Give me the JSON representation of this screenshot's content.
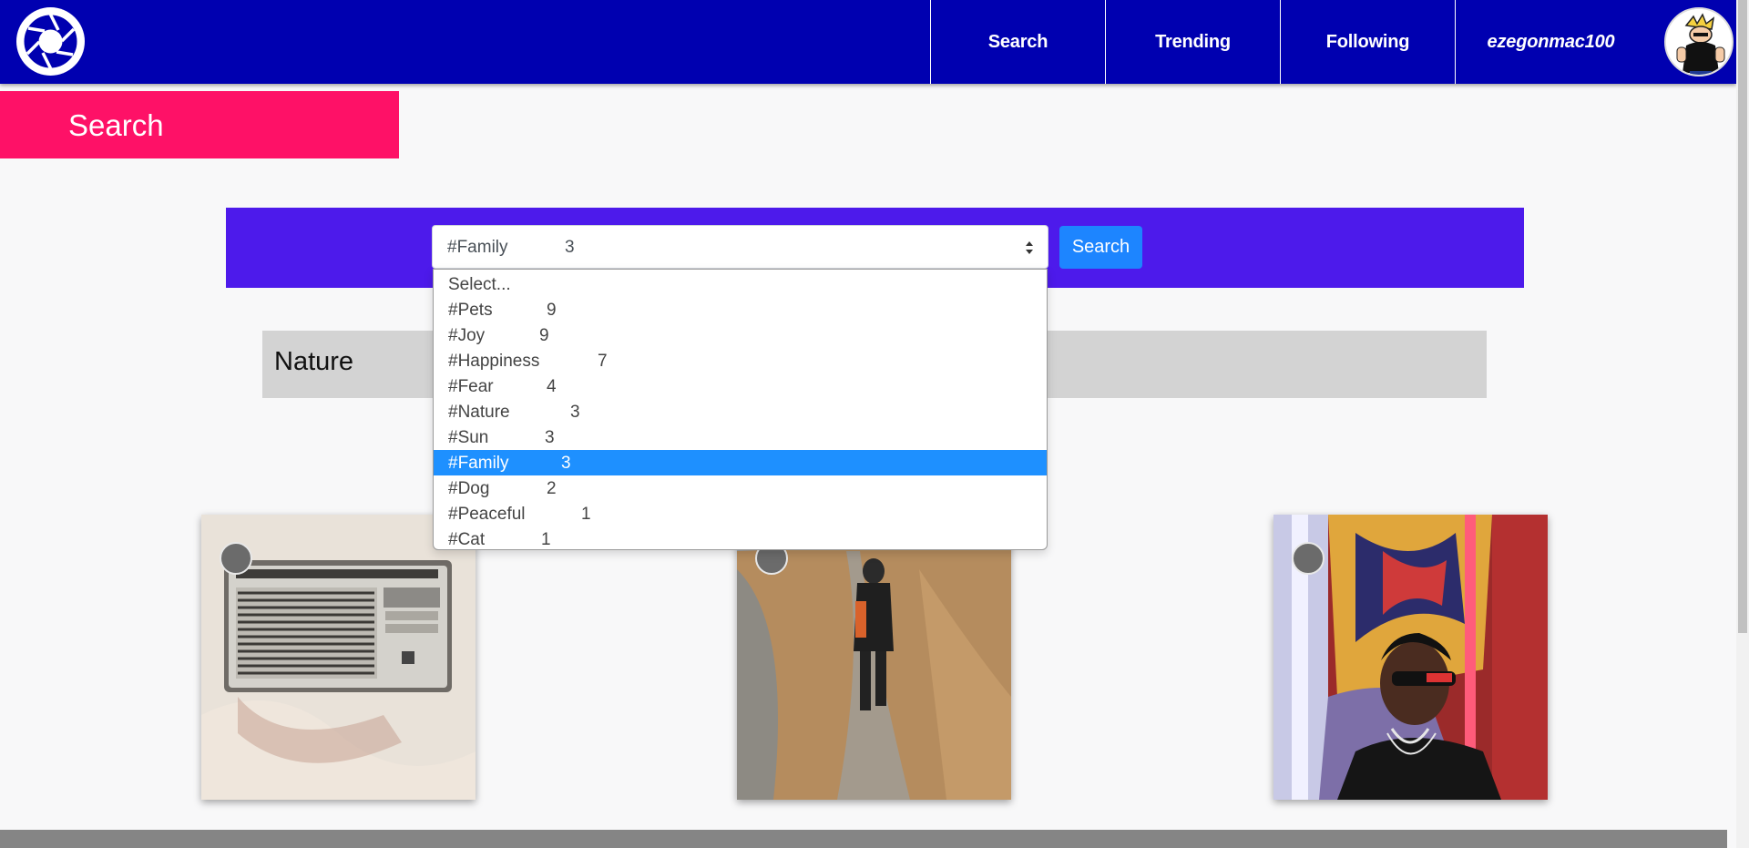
{
  "nav": {
    "logo_icon": "camera-shutter-icon",
    "links": [
      {
        "label": "Search"
      },
      {
        "label": "Trending"
      },
      {
        "label": "Following"
      }
    ],
    "username": "ezegonmac100",
    "avatar_icon": "cartoon-avatar-icon"
  },
  "page_header": {
    "title": "Search"
  },
  "search": {
    "selected": {
      "tag": "#Family",
      "count": "3"
    },
    "button_label": "Search",
    "options": [
      {
        "tag": "Select...",
        "count": ""
      },
      {
        "tag": "#Pets",
        "count": "9"
      },
      {
        "tag": "#Joy",
        "count": "9"
      },
      {
        "tag": "#Happiness",
        "count": "7"
      },
      {
        "tag": "#Fear",
        "count": "4"
      },
      {
        "tag": "#Nature",
        "count": "3"
      },
      {
        "tag": "#Sun",
        "count": "3"
      },
      {
        "tag": "#Family",
        "count": "3"
      },
      {
        "tag": "#Dog",
        "count": "2"
      },
      {
        "tag": "#Peaceful",
        "count": "1"
      },
      {
        "tag": "#Cat",
        "count": "1"
      }
    ],
    "selected_index": 7
  },
  "section": {
    "label": "Nature"
  },
  "colors": {
    "nav_bg": "#0000b0",
    "header_accent": "#fe1167",
    "search_band": "#4d1aeb",
    "button_blue": "#1d85ff",
    "selected_option": "#1e90ff"
  }
}
